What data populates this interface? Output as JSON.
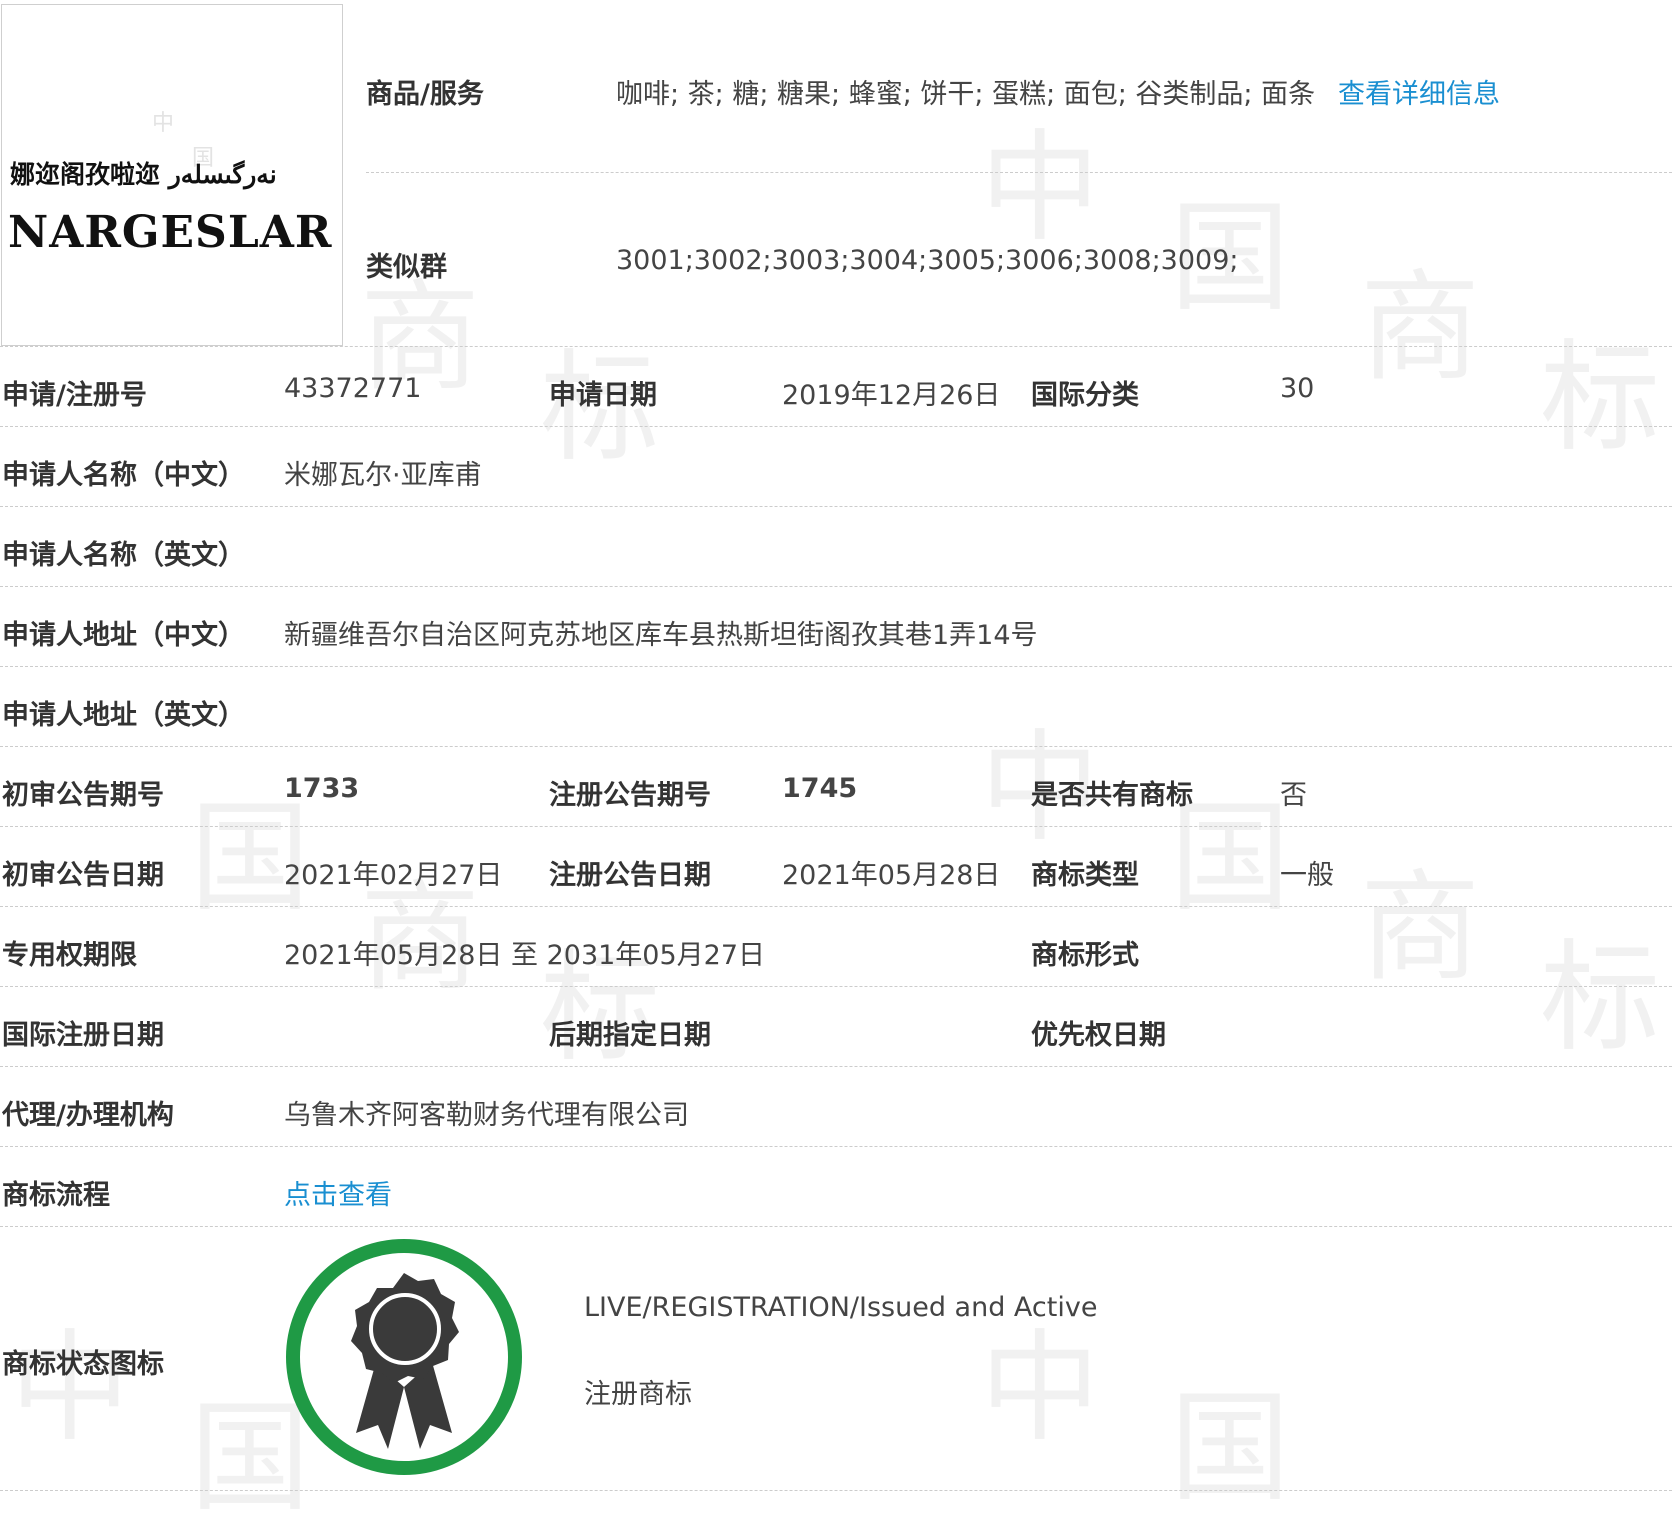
{
  "logo": {
    "text_local": "娜迩阁孜啦迩 نەرگىسلەر",
    "text_latin": "NARGESLAR"
  },
  "goods": {
    "label": "商品/服务",
    "value": "咖啡; 茶; 糖; 糖果; 蜂蜜; 饼干; 蛋糕; 面包; 谷类制品; 面条",
    "detail_link": "查看详细信息"
  },
  "similar_group": {
    "label": "类似群",
    "value": "3001;3002;3003;3004;3005;3006;3008;3009;"
  },
  "rows": {
    "reg_no": {
      "label": "申请/注册号",
      "value": "43372771"
    },
    "apply_date": {
      "label": "申请日期",
      "value": "2019年12月26日"
    },
    "intl_class": {
      "label": "国际分类",
      "value": "30"
    },
    "applicant_cn": {
      "label": "申请人名称（中文）",
      "value": "米娜瓦尔·亚库甫"
    },
    "applicant_en": {
      "label": "申请人名称（英文）",
      "value": ""
    },
    "address_cn": {
      "label": "申请人地址（中文）",
      "value": "新疆维吾尔自治区阿克苏地区库车县热斯坦街阁孜其巷1弄14号"
    },
    "address_en": {
      "label": "申请人地址（英文）",
      "value": ""
    },
    "prelim_pub_no": {
      "label": "初审公告期号",
      "value": "1733"
    },
    "reg_pub_no": {
      "label": "注册公告期号",
      "value": "1745"
    },
    "shared_mark": {
      "label": "是否共有商标",
      "value": "否"
    },
    "prelim_pub_date": {
      "label": "初审公告日期",
      "value": "2021年02月27日"
    },
    "reg_pub_date": {
      "label": "注册公告日期",
      "value": "2021年05月28日"
    },
    "mark_type": {
      "label": "商标类型",
      "value": "一般"
    },
    "exclusive_period": {
      "label": "专用权期限",
      "value": "2021年05月28日 至 2031年05月27日"
    },
    "mark_form": {
      "label": "商标形式",
      "value": ""
    },
    "intl_reg_date": {
      "label": "国际注册日期",
      "value": ""
    },
    "later_designation_date": {
      "label": "后期指定日期",
      "value": ""
    },
    "priority_date": {
      "label": "优先权日期",
      "value": ""
    },
    "agency": {
      "label": "代理/办理机构",
      "value": "乌鲁木齐阿客勒财务代理有限公司"
    },
    "process": {
      "label": "商标流程",
      "link": "点击查看"
    }
  },
  "status": {
    "label": "商标状态图标",
    "line1": "LIVE/REGISTRATION/Issued and Active",
    "line2": "注册商标",
    "ring_color": "#1f9a45",
    "badge_color": "#3a3a3a"
  },
  "watermark_text": [
    "中",
    "国",
    "商",
    "标"
  ]
}
